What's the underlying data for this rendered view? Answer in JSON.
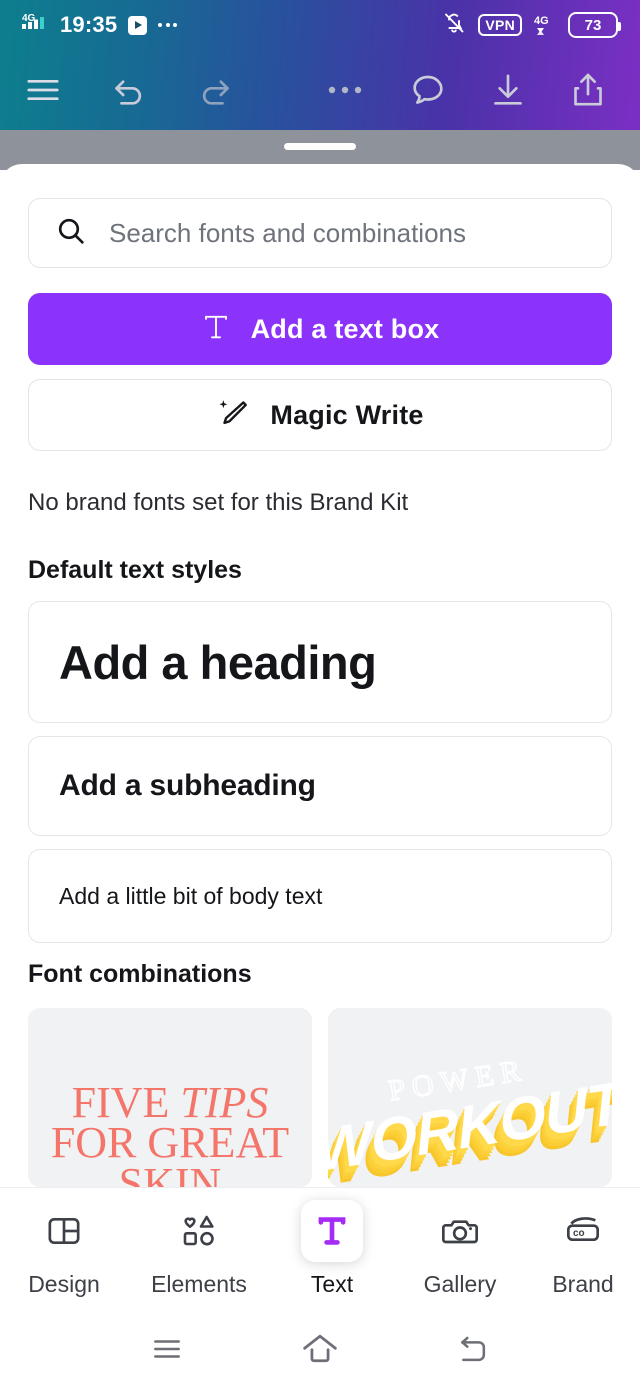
{
  "status_bar": {
    "network_type": "4G",
    "time": "19:35",
    "media_icon": "play-icon",
    "overflow_icon": "more-dots-icon",
    "silent_icon": "bell-off-icon",
    "vpn_label": "VPN",
    "data_network": "4G",
    "battery_level": "73"
  },
  "editor_toolbar": {
    "gradient_start": "#0d7f8e",
    "gradient_end": "#7b2fc4",
    "items": [
      {
        "name": "menu-button",
        "icon": "hamburger-icon"
      },
      {
        "name": "undo-button",
        "icon": "undo-arrow-icon"
      },
      {
        "name": "redo-button",
        "icon": "redo-arrow-icon"
      },
      {
        "name": "more-options-button",
        "icon": "more-dots-icon"
      },
      {
        "name": "comments-button",
        "icon": "speech-bubble-icon"
      },
      {
        "name": "download-button",
        "icon": "download-arrow-icon"
      },
      {
        "name": "share-button",
        "icon": "share-upload-icon"
      }
    ]
  },
  "sheet": {
    "drag_handle": "drag-handle",
    "search": {
      "icon": "search-icon",
      "placeholder": "Search fonts and combinations",
      "value": ""
    },
    "add_text_box": {
      "label": "Add a text box",
      "icon": "text-t-icon",
      "background": "#8b33fb"
    },
    "magic_write": {
      "label": "Magic Write",
      "icon": "magic-pencil-icon"
    },
    "brand_kit_note": "No brand fonts set for this Brand Kit",
    "default_styles": {
      "title": "Default text styles",
      "items": [
        {
          "label": "Add a heading",
          "style": "heading"
        },
        {
          "label": "Add a subheading",
          "style": "subheading"
        },
        {
          "label": "Add a little bit of body text",
          "style": "body"
        }
      ]
    },
    "font_combinations": {
      "title": "Font combinations",
      "cards": [
        {
          "name": "combo-card-five-tips",
          "line1": "FIVE ",
          "line1_italic": "TIPS",
          "line2": "FOR GREAT",
          "line3": "SKIN",
          "color": "#f4766b"
        },
        {
          "name": "combo-card-power-workout",
          "line1": "POWER",
          "line2": "WORKOUT",
          "color": "#ffd94a"
        }
      ]
    }
  },
  "bottom_nav": {
    "active": "Text",
    "accent": "#a52bf7",
    "items": [
      {
        "label": "Design",
        "icon": "layout-panel-icon"
      },
      {
        "label": "Elements",
        "icon": "shapes-icon"
      },
      {
        "label": "Text",
        "icon": "text-t-icon"
      },
      {
        "label": "Gallery",
        "icon": "camera-icon"
      },
      {
        "label": "Brand",
        "icon": "brand-kit-icon"
      }
    ]
  },
  "system_nav": {
    "items": [
      {
        "name": "recents-button",
        "icon": "hamburger-icon"
      },
      {
        "name": "home-button",
        "icon": "home-icon"
      },
      {
        "name": "back-button",
        "icon": "back-arrow-icon"
      }
    ]
  }
}
